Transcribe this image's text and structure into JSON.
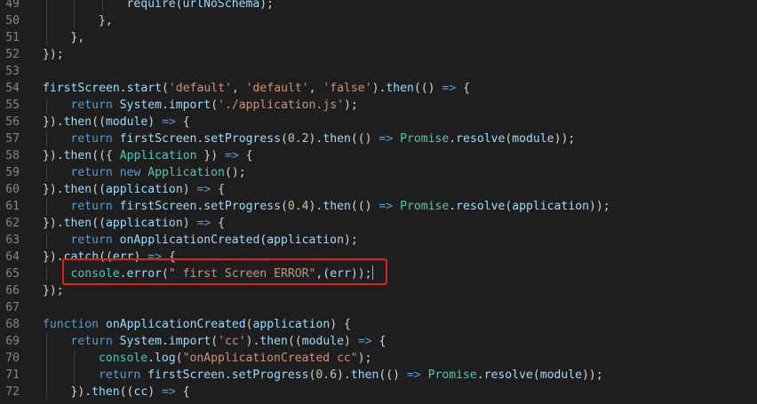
{
  "editor": {
    "lines": [
      {
        "n": "49",
        "indent": 3,
        "tokens": [
          {
            "t": "require",
            "c": "ctx-func"
          },
          {
            "t": "(",
            "c": "ctx-plain"
          },
          {
            "t": "urlNoSchema",
            "c": "ctx-param"
          },
          {
            "t": ");",
            "c": "ctx-plain"
          }
        ]
      },
      {
        "n": "50",
        "indent": 2,
        "tokens": [
          {
            "t": "},",
            "c": "ctx-plain"
          }
        ]
      },
      {
        "n": "51",
        "indent": 1,
        "tokens": [
          {
            "t": "},",
            "c": "ctx-plain"
          }
        ]
      },
      {
        "n": "52",
        "indent": 0,
        "tokens": [
          {
            "t": "});",
            "c": "ctx-plain"
          }
        ]
      },
      {
        "n": "53",
        "indent": 0,
        "tokens": []
      },
      {
        "n": "54",
        "indent": 0,
        "tokens": [
          {
            "t": "firstScreen",
            "c": "ctx-param"
          },
          {
            "t": ".",
            "c": "ctx-plain"
          },
          {
            "t": "start",
            "c": "ctx-func"
          },
          {
            "t": "(",
            "c": "ctx-plain"
          },
          {
            "t": "'default'",
            "c": "ctx-string"
          },
          {
            "t": ", ",
            "c": "ctx-plain"
          },
          {
            "t": "'default'",
            "c": "ctx-string"
          },
          {
            "t": ", ",
            "c": "ctx-plain"
          },
          {
            "t": "'false'",
            "c": "ctx-string"
          },
          {
            "t": ").",
            "c": "ctx-plain"
          },
          {
            "t": "then",
            "c": "ctx-func"
          },
          {
            "t": "(() ",
            "c": "ctx-plain"
          },
          {
            "t": "=>",
            "c": "ctx-keyword"
          },
          {
            "t": " {",
            "c": "ctx-plain"
          }
        ]
      },
      {
        "n": "55",
        "indent": 1,
        "tokens": [
          {
            "t": "return",
            "c": "ctx-control"
          },
          {
            "t": " ",
            "c": "ctx-plain"
          },
          {
            "t": "System",
            "c": "ctx-param"
          },
          {
            "t": ".",
            "c": "ctx-plain"
          },
          {
            "t": "import",
            "c": "ctx-func"
          },
          {
            "t": "(",
            "c": "ctx-plain"
          },
          {
            "t": "'./application.js'",
            "c": "ctx-string"
          },
          {
            "t": ");",
            "c": "ctx-plain"
          }
        ]
      },
      {
        "n": "56",
        "indent": 0,
        "tokens": [
          {
            "t": "}).",
            "c": "ctx-plain"
          },
          {
            "t": "then",
            "c": "ctx-func"
          },
          {
            "t": "((",
            "c": "ctx-plain"
          },
          {
            "t": "module",
            "c": "ctx-param"
          },
          {
            "t": ") ",
            "c": "ctx-plain"
          },
          {
            "t": "=>",
            "c": "ctx-keyword"
          },
          {
            "t": " {",
            "c": "ctx-plain"
          }
        ]
      },
      {
        "n": "57",
        "indent": 1,
        "tokens": [
          {
            "t": "return",
            "c": "ctx-control"
          },
          {
            "t": " ",
            "c": "ctx-plain"
          },
          {
            "t": "firstScreen",
            "c": "ctx-param"
          },
          {
            "t": ".",
            "c": "ctx-plain"
          },
          {
            "t": "setProgress",
            "c": "ctx-func"
          },
          {
            "t": "(",
            "c": "ctx-plain"
          },
          {
            "t": "0.2",
            "c": "ctx-number"
          },
          {
            "t": ").",
            "c": "ctx-plain"
          },
          {
            "t": "then",
            "c": "ctx-func"
          },
          {
            "t": "(() ",
            "c": "ctx-plain"
          },
          {
            "t": "=>",
            "c": "ctx-keyword"
          },
          {
            "t": " ",
            "c": "ctx-plain"
          },
          {
            "t": "Promise",
            "c": "ctx-class"
          },
          {
            "t": ".",
            "c": "ctx-plain"
          },
          {
            "t": "resolve",
            "c": "ctx-func"
          },
          {
            "t": "(",
            "c": "ctx-plain"
          },
          {
            "t": "module",
            "c": "ctx-param"
          },
          {
            "t": "));",
            "c": "ctx-plain"
          }
        ]
      },
      {
        "n": "58",
        "indent": 0,
        "tokens": [
          {
            "t": "}).",
            "c": "ctx-plain"
          },
          {
            "t": "then",
            "c": "ctx-func"
          },
          {
            "t": "(({ ",
            "c": "ctx-plain"
          },
          {
            "t": "Application",
            "c": "ctx-class"
          },
          {
            "t": " }) ",
            "c": "ctx-plain"
          },
          {
            "t": "=>",
            "c": "ctx-keyword"
          },
          {
            "t": " {",
            "c": "ctx-plain"
          }
        ]
      },
      {
        "n": "59",
        "indent": 1,
        "tokens": [
          {
            "t": "return",
            "c": "ctx-control"
          },
          {
            "t": " ",
            "c": "ctx-plain"
          },
          {
            "t": "new",
            "c": "ctx-keyword"
          },
          {
            "t": " ",
            "c": "ctx-plain"
          },
          {
            "t": "Application",
            "c": "ctx-class"
          },
          {
            "t": "();",
            "c": "ctx-plain"
          }
        ]
      },
      {
        "n": "60",
        "indent": 0,
        "tokens": [
          {
            "t": "}).",
            "c": "ctx-plain"
          },
          {
            "t": "then",
            "c": "ctx-func"
          },
          {
            "t": "((",
            "c": "ctx-plain"
          },
          {
            "t": "application",
            "c": "ctx-param"
          },
          {
            "t": ") ",
            "c": "ctx-plain"
          },
          {
            "t": "=>",
            "c": "ctx-keyword"
          },
          {
            "t": " {",
            "c": "ctx-plain"
          }
        ]
      },
      {
        "n": "61",
        "indent": 1,
        "tokens": [
          {
            "t": "return",
            "c": "ctx-control"
          },
          {
            "t": " ",
            "c": "ctx-plain"
          },
          {
            "t": "firstScreen",
            "c": "ctx-param"
          },
          {
            "t": ".",
            "c": "ctx-plain"
          },
          {
            "t": "setProgress",
            "c": "ctx-func"
          },
          {
            "t": "(",
            "c": "ctx-plain"
          },
          {
            "t": "0.4",
            "c": "ctx-number"
          },
          {
            "t": ").",
            "c": "ctx-plain"
          },
          {
            "t": "then",
            "c": "ctx-func"
          },
          {
            "t": "(() ",
            "c": "ctx-plain"
          },
          {
            "t": "=>",
            "c": "ctx-keyword"
          },
          {
            "t": " ",
            "c": "ctx-plain"
          },
          {
            "t": "Promise",
            "c": "ctx-class"
          },
          {
            "t": ".",
            "c": "ctx-plain"
          },
          {
            "t": "resolve",
            "c": "ctx-func"
          },
          {
            "t": "(",
            "c": "ctx-plain"
          },
          {
            "t": "application",
            "c": "ctx-param"
          },
          {
            "t": "));",
            "c": "ctx-plain"
          }
        ]
      },
      {
        "n": "62",
        "indent": 0,
        "tokens": [
          {
            "t": "}).",
            "c": "ctx-plain"
          },
          {
            "t": "then",
            "c": "ctx-func"
          },
          {
            "t": "((",
            "c": "ctx-plain"
          },
          {
            "t": "application",
            "c": "ctx-param"
          },
          {
            "t": ") ",
            "c": "ctx-plain"
          },
          {
            "t": "=>",
            "c": "ctx-keyword"
          },
          {
            "t": " {",
            "c": "ctx-plain"
          }
        ]
      },
      {
        "n": "63",
        "indent": 1,
        "tokens": [
          {
            "t": "return",
            "c": "ctx-control"
          },
          {
            "t": " ",
            "c": "ctx-plain"
          },
          {
            "t": "onApplicationCreated",
            "c": "ctx-func"
          },
          {
            "t": "(",
            "c": "ctx-plain"
          },
          {
            "t": "application",
            "c": "ctx-param"
          },
          {
            "t": ");",
            "c": "ctx-plain"
          }
        ]
      },
      {
        "n": "64",
        "indent": 0,
        "tokens": [
          {
            "t": "}).",
            "c": "ctx-plain"
          },
          {
            "t": "catch",
            "c": "ctx-func"
          },
          {
            "t": "((",
            "c": "ctx-plain"
          },
          {
            "t": "err",
            "c": "ctx-param"
          },
          {
            "t": ") ",
            "c": "ctx-plain"
          },
          {
            "t": "=>",
            "c": "ctx-keyword"
          },
          {
            "t": " {",
            "c": "ctx-plain"
          }
        ]
      },
      {
        "n": "65",
        "indent": 1,
        "cursor": true,
        "tokens": [
          {
            "t": "console",
            "c": "ctx-class"
          },
          {
            "t": ".",
            "c": "ctx-plain"
          },
          {
            "t": "error",
            "c": "ctx-func"
          },
          {
            "t": "(",
            "c": "ctx-plain"
          },
          {
            "t": "\" first Screen ERROR\"",
            "c": "ctx-string"
          },
          {
            "t": ",(",
            "c": "ctx-plain"
          },
          {
            "t": "err",
            "c": "ctx-param"
          },
          {
            "t": "));",
            "c": "ctx-plain"
          }
        ]
      },
      {
        "n": "66",
        "indent": 0,
        "tokens": [
          {
            "t": "});",
            "c": "ctx-plain"
          }
        ]
      },
      {
        "n": "67",
        "indent": 0,
        "tokens": []
      },
      {
        "n": "68",
        "indent": 0,
        "tokens": [
          {
            "t": "function",
            "c": "ctx-keyword"
          },
          {
            "t": " ",
            "c": "ctx-plain"
          },
          {
            "t": "onApplicationCreated",
            "c": "ctx-func"
          },
          {
            "t": "(",
            "c": "ctx-plain"
          },
          {
            "t": "application",
            "c": "ctx-param"
          },
          {
            "t": ") {",
            "c": "ctx-plain"
          }
        ]
      },
      {
        "n": "69",
        "indent": 1,
        "tokens": [
          {
            "t": "return",
            "c": "ctx-control"
          },
          {
            "t": " ",
            "c": "ctx-plain"
          },
          {
            "t": "System",
            "c": "ctx-param"
          },
          {
            "t": ".",
            "c": "ctx-plain"
          },
          {
            "t": "import",
            "c": "ctx-func"
          },
          {
            "t": "(",
            "c": "ctx-plain"
          },
          {
            "t": "'cc'",
            "c": "ctx-string"
          },
          {
            "t": ").",
            "c": "ctx-plain"
          },
          {
            "t": "then",
            "c": "ctx-func"
          },
          {
            "t": "((",
            "c": "ctx-plain"
          },
          {
            "t": "module",
            "c": "ctx-param"
          },
          {
            "t": ") ",
            "c": "ctx-plain"
          },
          {
            "t": "=>",
            "c": "ctx-keyword"
          },
          {
            "t": " {",
            "c": "ctx-plain"
          }
        ]
      },
      {
        "n": "70",
        "indent": 2,
        "tokens": [
          {
            "t": "console",
            "c": "ctx-class"
          },
          {
            "t": ".",
            "c": "ctx-plain"
          },
          {
            "t": "log",
            "c": "ctx-func"
          },
          {
            "t": "(",
            "c": "ctx-plain"
          },
          {
            "t": "\"onApplicationCreated cc\"",
            "c": "ctx-string"
          },
          {
            "t": ");",
            "c": "ctx-plain"
          }
        ]
      },
      {
        "n": "71",
        "indent": 2,
        "tokens": [
          {
            "t": "return",
            "c": "ctx-control"
          },
          {
            "t": " ",
            "c": "ctx-plain"
          },
          {
            "t": "firstScreen",
            "c": "ctx-param"
          },
          {
            "t": ".",
            "c": "ctx-plain"
          },
          {
            "t": "setProgress",
            "c": "ctx-func"
          },
          {
            "t": "(",
            "c": "ctx-plain"
          },
          {
            "t": "0.6",
            "c": "ctx-number"
          },
          {
            "t": ").",
            "c": "ctx-plain"
          },
          {
            "t": "then",
            "c": "ctx-func"
          },
          {
            "t": "(() ",
            "c": "ctx-plain"
          },
          {
            "t": "=>",
            "c": "ctx-keyword"
          },
          {
            "t": " ",
            "c": "ctx-plain"
          },
          {
            "t": "Promise",
            "c": "ctx-class"
          },
          {
            "t": ".",
            "c": "ctx-plain"
          },
          {
            "t": "resolve",
            "c": "ctx-func"
          },
          {
            "t": "(",
            "c": "ctx-plain"
          },
          {
            "t": "module",
            "c": "ctx-param"
          },
          {
            "t": "));",
            "c": "ctx-plain"
          }
        ]
      },
      {
        "n": "72",
        "indent": 1,
        "tokens": [
          {
            "t": "}).",
            "c": "ctx-plain"
          },
          {
            "t": "then",
            "c": "ctx-func"
          },
          {
            "t": "((",
            "c": "ctx-plain"
          },
          {
            "t": "cc",
            "c": "ctx-param"
          },
          {
            "t": ") ",
            "c": "ctx-plain"
          },
          {
            "t": "=>",
            "c": "ctx-keyword"
          },
          {
            "t": " {",
            "c": "ctx-plain"
          }
        ]
      }
    ]
  },
  "colors": {
    "background": "#1e1e1e",
    "highlight_box": "#e0201c"
  }
}
